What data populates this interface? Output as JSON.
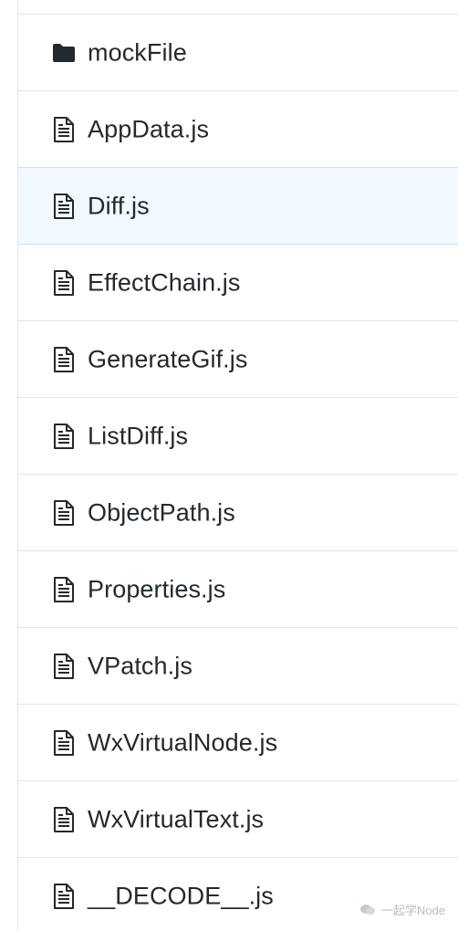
{
  "files": [
    {
      "name": "mockFile",
      "icon": "folder-icon",
      "type": "folder"
    },
    {
      "name": "AppData.js",
      "icon": "file-text-icon",
      "type": "file"
    },
    {
      "name": "Diff.js",
      "icon": "file-text-icon",
      "type": "file",
      "highlighted": true
    },
    {
      "name": "EffectChain.js",
      "icon": "file-text-icon",
      "type": "file"
    },
    {
      "name": "GenerateGif.js",
      "icon": "file-text-icon",
      "type": "file"
    },
    {
      "name": "ListDiff.js",
      "icon": "file-text-icon",
      "type": "file"
    },
    {
      "name": "ObjectPath.js",
      "icon": "file-text-icon",
      "type": "file"
    },
    {
      "name": "Properties.js",
      "icon": "file-text-icon",
      "type": "file"
    },
    {
      "name": "VPatch.js",
      "icon": "file-text-icon",
      "type": "file"
    },
    {
      "name": "WxVirtualNode.js",
      "icon": "file-text-icon",
      "type": "file"
    },
    {
      "name": "WxVirtualText.js",
      "icon": "file-text-icon",
      "type": "file"
    },
    {
      "name": "__DECODE__.js",
      "icon": "file-text-icon",
      "type": "file"
    }
  ],
  "watermark": {
    "text": "一起学Node",
    "icon": "wechat-icon"
  },
  "colors": {
    "text": "#24292e",
    "border": "#e1e4e8",
    "highlight_bg": "#f1f8ff",
    "highlight_border": "#c8e1ff",
    "icon": "#24292e"
  }
}
